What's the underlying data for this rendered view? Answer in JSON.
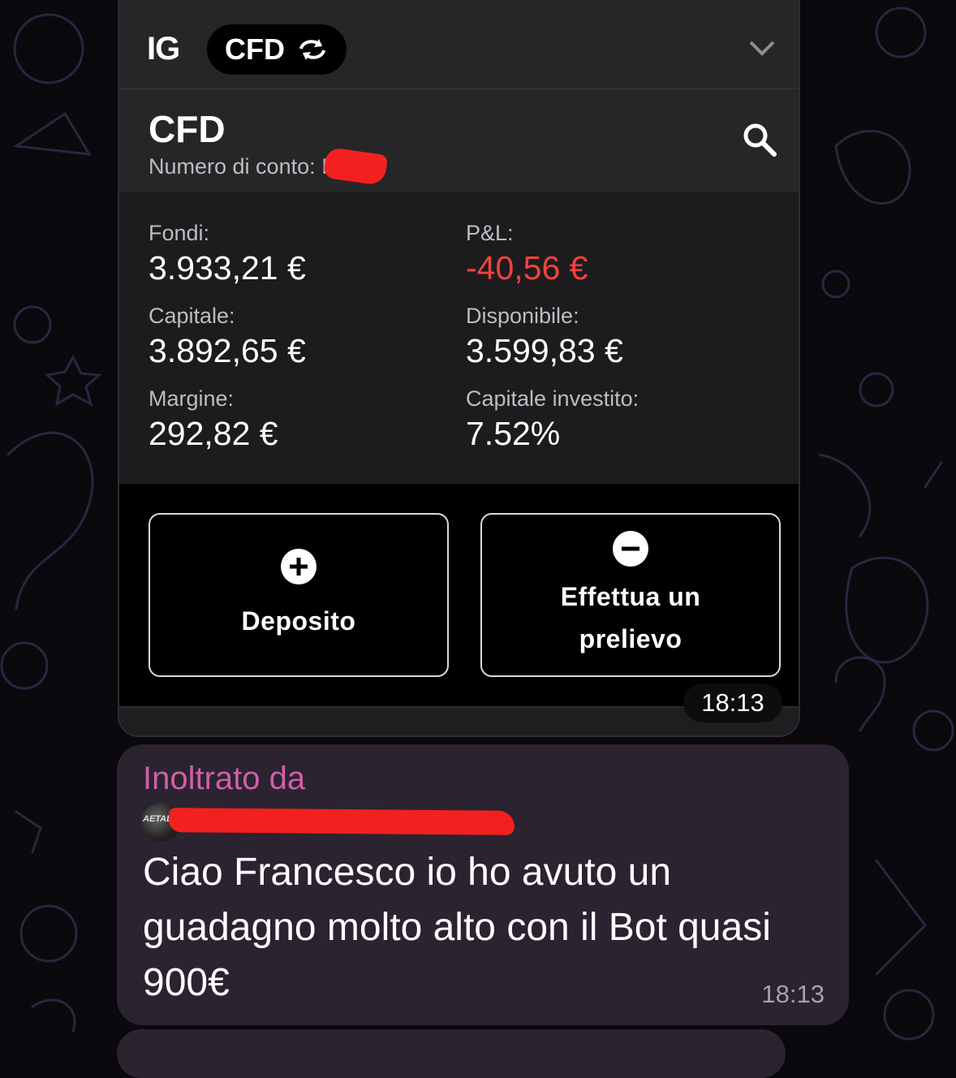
{
  "header": {
    "brand": "IG",
    "account_type_pill": "CFD"
  },
  "account": {
    "title": "CFD",
    "number_label": "Numero di conto: I"
  },
  "stats": {
    "fondi_label": "Fondi:",
    "fondi_value": "3.933,21 €",
    "pl_label": "P&L:",
    "pl_value": "-40,56 €",
    "capitale_label": "Capitale:",
    "capitale_value": "3.892,65 €",
    "disponibile_label": "Disponibile:",
    "disponibile_value": "3.599,83 €",
    "margine_label": "Margine:",
    "margine_value": "292,82 €",
    "investito_label": "Capitale investito:",
    "investito_value": "7.52%"
  },
  "actions": {
    "deposit_label": "Deposito",
    "withdraw_line1": "Effettua un",
    "withdraw_line2": "prelievo"
  },
  "messages": [
    {
      "time": "18:13"
    },
    {
      "forwarded_label": "Inoltrato da",
      "avatar_text": "AETAL",
      "text": "Ciao Francesco io ho avuto un guadagno molto alto con il Bot quasi 900€",
      "time": "18:13"
    }
  ],
  "colors": {
    "negative": "#f0433c",
    "forward_accent": "#d05fa7",
    "bubble": "#2b2330"
  }
}
